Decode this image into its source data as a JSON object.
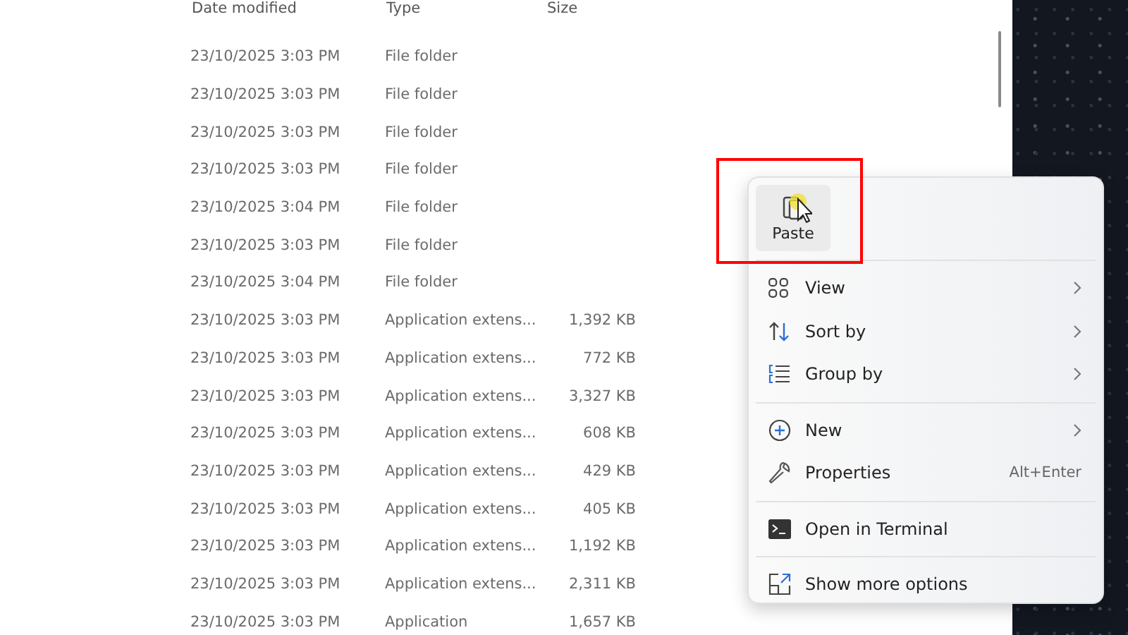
{
  "columns": [
    {
      "label": "Date modified"
    },
    {
      "label": "Type"
    },
    {
      "label": "Size"
    }
  ],
  "rows": [
    {
      "date": "23/10/2025 3:03 PM",
      "type": "File folder",
      "size": ""
    },
    {
      "date": "23/10/2025 3:03 PM",
      "type": "File folder",
      "size": ""
    },
    {
      "date": "23/10/2025 3:03 PM",
      "type": "File folder",
      "size": ""
    },
    {
      "date": "23/10/2025 3:03 PM",
      "type": "File folder",
      "size": ""
    },
    {
      "date": "23/10/2025 3:04 PM",
      "type": "File folder",
      "size": ""
    },
    {
      "date": "23/10/2025 3:03 PM",
      "type": "File folder",
      "size": ""
    },
    {
      "date": "23/10/2025 3:04 PM",
      "type": "File folder",
      "size": ""
    },
    {
      "date": "23/10/2025 3:03 PM",
      "type": "Application extens...",
      "size": "1,392 KB"
    },
    {
      "date": "23/10/2025 3:03 PM",
      "type": "Application extens...",
      "size": "772 KB"
    },
    {
      "date": "23/10/2025 3:03 PM",
      "type": "Application extens...",
      "size": "3,327 KB"
    },
    {
      "date": "23/10/2025 3:03 PM",
      "type": "Application extens...",
      "size": "608 KB"
    },
    {
      "date": "23/10/2025 3:03 PM",
      "type": "Application extens...",
      "size": "429 KB"
    },
    {
      "date": "23/10/2025 3:03 PM",
      "type": "Application extens...",
      "size": "405 KB"
    },
    {
      "date": "23/10/2025 3:03 PM",
      "type": "Application extens...",
      "size": "1,192 KB"
    },
    {
      "date": "23/10/2025 3:03 PM",
      "type": "Application extens...",
      "size": "2,311 KB"
    },
    {
      "date": "23/10/2025 3:03 PM",
      "type": "Application",
      "size": "1,657 KB"
    }
  ],
  "context_menu": {
    "paste": {
      "label": "Paste",
      "highlighted": true
    },
    "groups": [
      [
        {
          "kind": "grid",
          "label": "View",
          "submenu": true
        },
        {
          "kind": "sort",
          "label": "Sort by",
          "submenu": true
        },
        {
          "kind": "list",
          "label": "Group by",
          "submenu": true
        }
      ],
      [
        {
          "kind": "plus",
          "label": "New",
          "submenu": true
        },
        {
          "kind": "wrench",
          "label": "Properties",
          "submenu": false,
          "shortcut": "Alt+Enter"
        }
      ],
      [
        {
          "kind": "terminal",
          "label": "Open in Terminal",
          "submenu": false
        }
      ],
      [
        {
          "kind": "external",
          "label": "Show more options",
          "submenu": false
        }
      ]
    ]
  }
}
